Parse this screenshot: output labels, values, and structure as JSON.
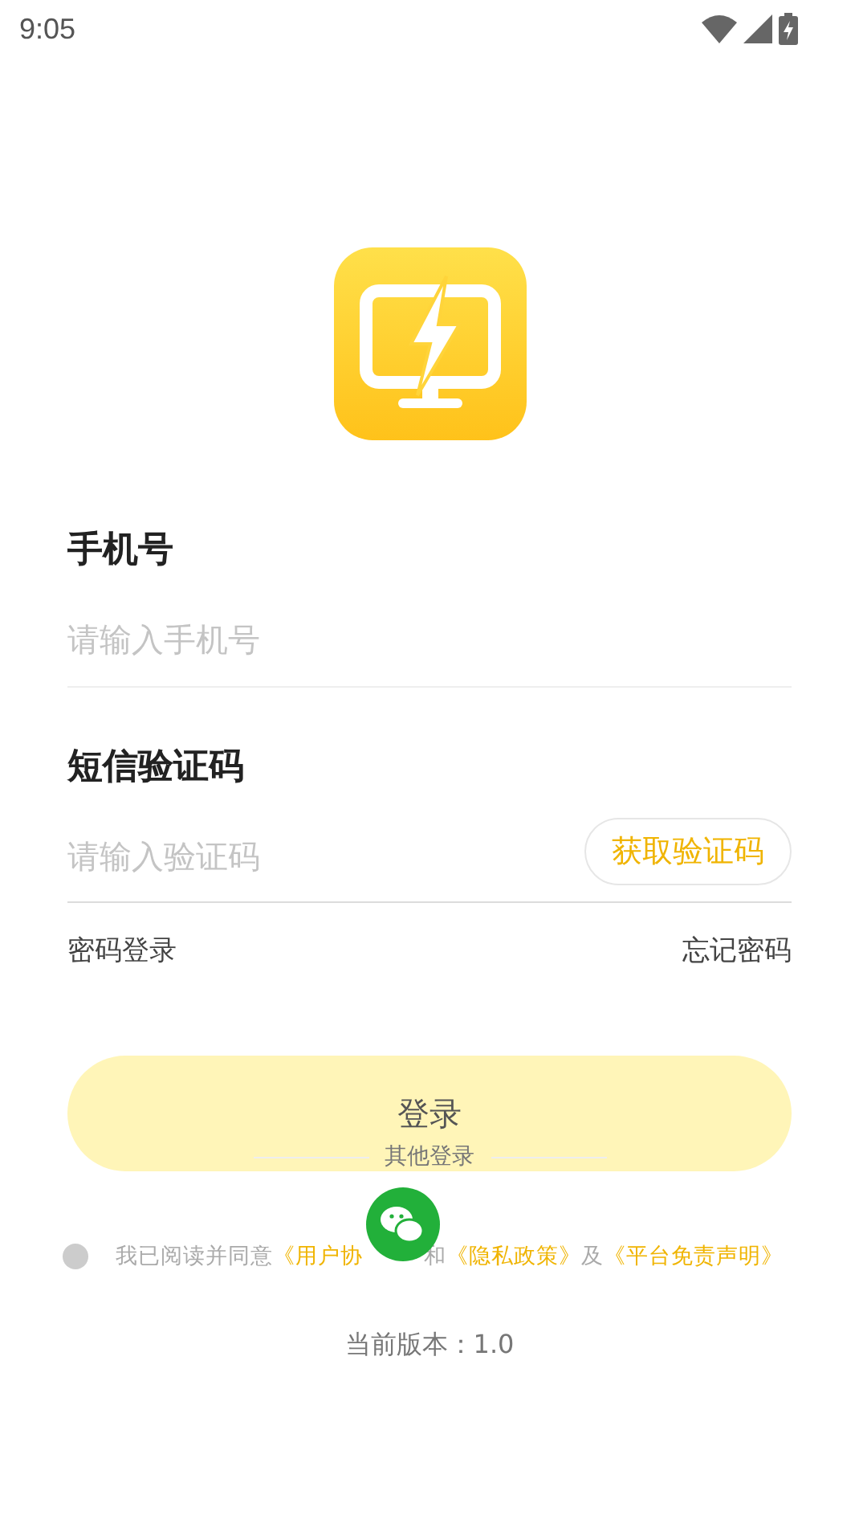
{
  "status_bar": {
    "time": "9:05"
  },
  "phone": {
    "label": "手机号",
    "placeholder": "请输入手机号"
  },
  "code": {
    "label": "短信验证码",
    "placeholder": "请输入验证码",
    "button": "获取验证码"
  },
  "links": {
    "password_login": "密码登录",
    "forgot_password": "忘记密码"
  },
  "login_button": "登录",
  "other_login": {
    "label": "其他登录"
  },
  "agreement": {
    "checked": false,
    "parts": [
      {
        "kind": "text",
        "text": "我已阅读并同意"
      },
      {
        "kind": "link",
        "text": "《用户协"
      },
      {
        "kind": "hidden"
      },
      {
        "kind": "text",
        "text": "和"
      },
      {
        "kind": "link",
        "text": "《隐私政策》"
      },
      {
        "kind": "text",
        "text": "及"
      },
      {
        "kind": "link",
        "text": "《平台免责声明》"
      }
    ]
  },
  "version": "当前版本：1.0"
}
